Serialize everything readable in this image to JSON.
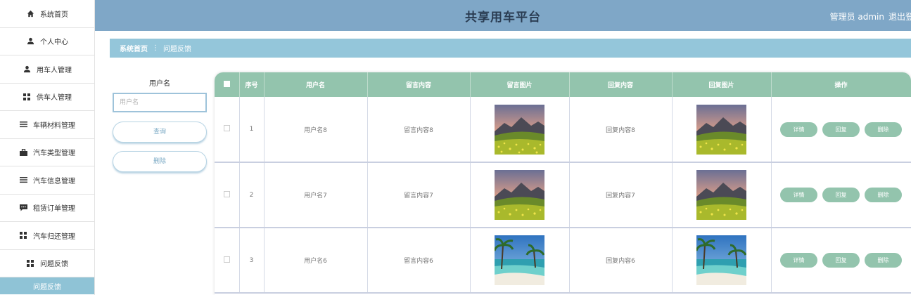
{
  "sidebar": {
    "items": [
      {
        "label": "系统首页",
        "icon": "home-icon"
      },
      {
        "label": "个人中心",
        "icon": "person-icon"
      },
      {
        "label": "用车人管理",
        "icon": "person-icon"
      },
      {
        "label": "供车人管理",
        "icon": "grid-icon"
      },
      {
        "label": "车辆材料管理",
        "icon": "list-icon"
      },
      {
        "label": "汽车类型管理",
        "icon": "briefcase-icon"
      },
      {
        "label": "汽车信息管理",
        "icon": "list-icon"
      },
      {
        "label": "租赁订单管理",
        "icon": "chat-icon"
      },
      {
        "label": "汽车归还管理",
        "icon": "grid-icon"
      },
      {
        "label": "问题反馈",
        "icon": "grid-icon"
      }
    ],
    "sub_item": "问题反馈"
  },
  "header": {
    "title": "共享用车平台",
    "user": "管理员 admin",
    "logout": "退出登"
  },
  "breadcrumb": {
    "home": "系统首页",
    "separator": "/",
    "current": "问题反馈"
  },
  "search": {
    "username_label": "用户名",
    "username_placeholder": "用户名",
    "query_button": "查询",
    "delete_button": "删除"
  },
  "table": {
    "columns": [
      "",
      "序号",
      "用户名",
      "留言内容",
      "留言图片",
      "回复内容",
      "回复图片",
      "操作"
    ],
    "rows": [
      {
        "index": "1",
        "username": "用户名8",
        "message": "留言内容8",
        "message_image": "mountain-meadow",
        "reply": "回复内容8",
        "reply_image": "mountain-meadow"
      },
      {
        "index": "2",
        "username": "用户名7",
        "message": "留言内容7",
        "message_image": "mountain-meadow",
        "reply": "回复内容7",
        "reply_image": "mountain-meadow"
      },
      {
        "index": "3",
        "username": "用户名6",
        "message": "留言内容6",
        "message_image": "tropical-beach",
        "reply": "回复内容6",
        "reply_image": "tropical-beach"
      }
    ],
    "actions": {
      "detail": "详情",
      "reply": "回复",
      "delete": "删除"
    }
  },
  "colors": {
    "header_bg": "#7fa7c7",
    "breadcrumb_bg": "#94c6da",
    "table_header_bg": "#93c4ad",
    "action_button_bg": "#93c4ad",
    "active_sub_bg": "#8fc3d6"
  }
}
